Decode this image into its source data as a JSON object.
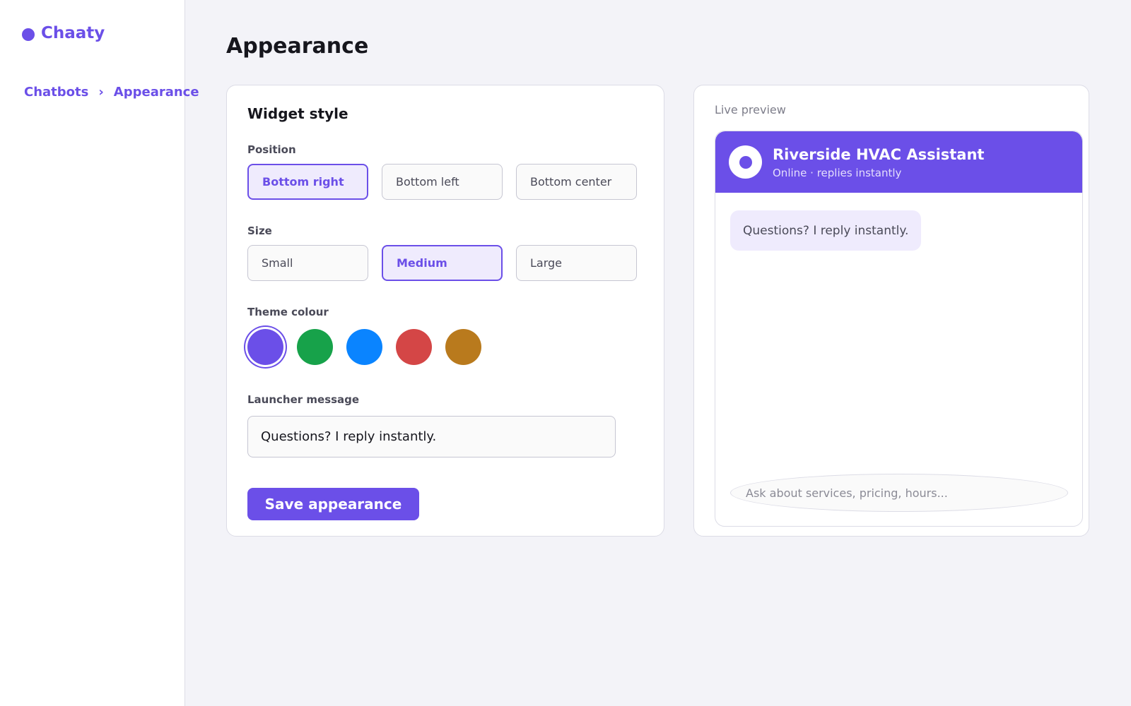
{
  "app": {
    "name": "Chaaty"
  },
  "breadcrumb": {
    "items": [
      "Chatbots",
      "Appearance"
    ],
    "separator": "›"
  },
  "page": {
    "title": "Appearance"
  },
  "widget_style": {
    "title": "Widget style",
    "position": {
      "label": "Position",
      "options": [
        "Bottom right",
        "Bottom left",
        "Bottom center"
      ],
      "selected": "Bottom right"
    },
    "size": {
      "label": "Size",
      "options": [
        "Small",
        "Medium",
        "Large"
      ],
      "selected": "Medium"
    },
    "theme_colour": {
      "label": "Theme colour",
      "swatches": [
        "#6b4fe8",
        "#17a24a",
        "#0a84ff",
        "#d44646",
        "#b97a1d"
      ],
      "selected": "#6b4fe8"
    },
    "launcher_message": {
      "label": "Launcher message",
      "value": "Questions? I reply instantly."
    },
    "save_label": "Save appearance"
  },
  "preview": {
    "label": "Live preview",
    "bot_name": "Riverside HVAC Assistant",
    "bot_status": "Online · replies instantly",
    "message": "Questions? I reply instantly.",
    "input_placeholder": "Ask about services, pricing, hours..."
  },
  "colors": {
    "accent": "#6b4fe8",
    "accent_soft": "#efebfd",
    "page_bg": "#f3f3f8"
  }
}
